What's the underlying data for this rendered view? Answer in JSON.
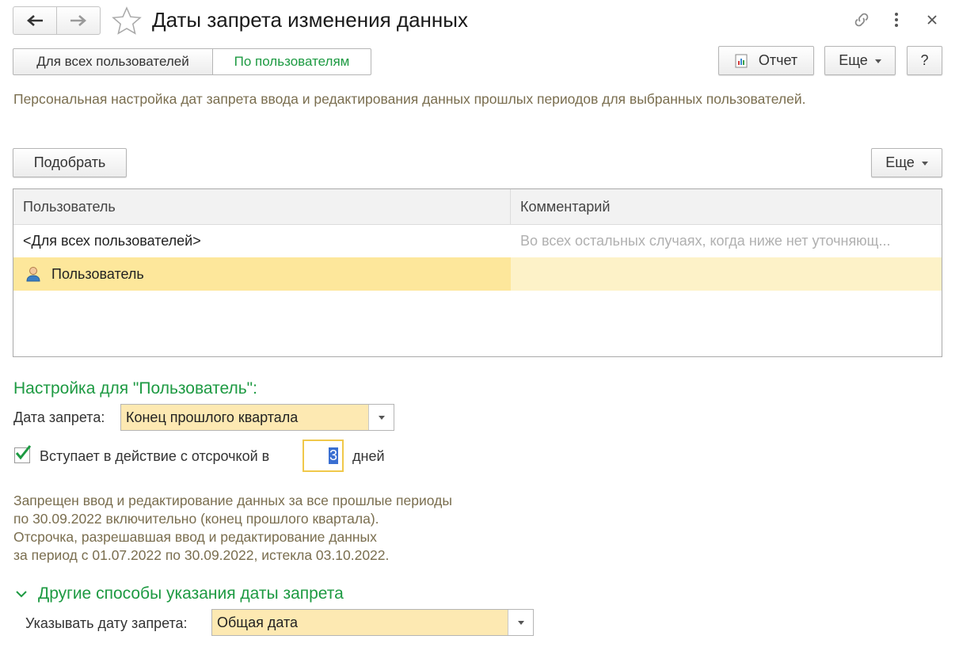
{
  "header": {
    "title": "Даты запрета изменения данных"
  },
  "tabs": [
    {
      "label": "Для всех пользователей",
      "active": false
    },
    {
      "label": "По пользователям",
      "active": true
    }
  ],
  "toolbar": {
    "report_label": "Отчет",
    "more_label": "Еще",
    "help_label": "?"
  },
  "description": "Персональная настройка дат запрета ввода и редактирования данных прошлых периодов для выбранных пользователей.",
  "list_toolbar": {
    "pick_label": "Подобрать",
    "more_label": "Еще"
  },
  "table": {
    "columns": [
      "Пользователь",
      "Комментарий"
    ],
    "rows": [
      {
        "user": "<Для всех пользователей>",
        "comment": "Во всех остальных случаях, когда ниже нет уточняющ..."
      },
      {
        "user": "Пользователь",
        "comment": "",
        "selected": true,
        "icon": "user-icon"
      }
    ]
  },
  "settings": {
    "heading": "Настройка для \"Пользователь\":",
    "date_label": "Дата запрета:",
    "date_value": "Конец прошлого квартала",
    "delay_checked": true,
    "delay_label": "Вступает в действие с отсрочкой в",
    "delay_value": "3",
    "delay_unit": "дней",
    "info_lines": [
      "Запрещен ввод и редактирование данных за все прошлые периоды",
      "по 30.09.2022 включительно (конец прошлого квартала).",
      "Отсрочка, разрешавшая ввод и редактирование данных",
      "за период с 01.07.2022 по 30.09.2022, истекла 03.10.2022."
    ]
  },
  "other": {
    "heading": "Другие способы указания даты запрета",
    "label": "Указывать дату запрета:",
    "value": "Общая дата"
  },
  "colors": {
    "accent_green": "#1d9a42",
    "selected_row": "#fde79b",
    "field_bg": "#fde9b2",
    "hint_text": "#7a6e4f"
  }
}
